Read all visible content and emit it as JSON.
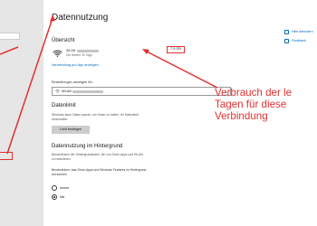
{
  "page_title": "Datennutzung",
  "overview": {
    "heading": "Übersicht",
    "network_label": "WLAN",
    "network_sub": "Die letzten 30 Tage",
    "usage_value": "7,9 GB",
    "per_app_link": "Verwendung pro App anzeigen"
  },
  "settings_for": {
    "label": "Einstellungen anzeigen für:",
    "selected_value": "WLAN"
  },
  "data_limit": {
    "heading": "Datenlimit",
    "description_1": "Windows kann Daten sparen, um Ihnen zu helfen, Ihr Datenlimit",
    "description_2": "einzuhalten.",
    "button_label": "Limit festlegen"
  },
  "background": {
    "heading": "Datennutzung im Hintergrund",
    "description_1": "Beschränken der Hintergrunddaten, die von Store-Apps und WLAN",
    "description_2": "zu reduzieren.",
    "restrict_label_1": "Beschränken, was Store-Apps und Windows Features im Hintergrund",
    "restrict_label_2": "tun können",
    "options": [
      "Immer",
      "Nie"
    ]
  },
  "right_links": [
    "Hilfe anfordern",
    "Feedback"
  ],
  "annotation": {
    "line1": "Verbrauch der le",
    "line2": "Tagen für diese",
    "line3": "Verbindung"
  },
  "colors": {
    "annotation": "#e0312f",
    "link": "#0067c0",
    "sidebar": "#e6e6e6"
  }
}
